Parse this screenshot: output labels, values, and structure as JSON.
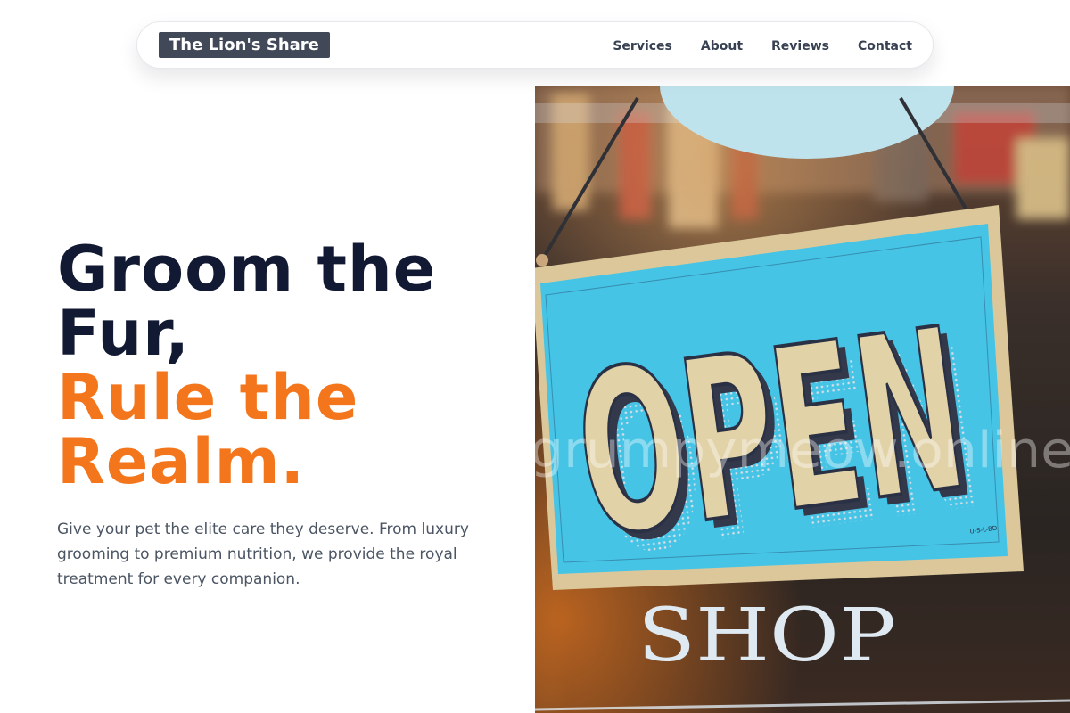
{
  "brand": {
    "name": "The Lion's Share"
  },
  "nav": {
    "items": [
      {
        "label": "Services"
      },
      {
        "label": "About"
      },
      {
        "label": "Reviews"
      },
      {
        "label": "Contact"
      }
    ]
  },
  "hero": {
    "title_lines": [
      "Groom the",
      "Fur,"
    ],
    "accent_lines": [
      "Rule the",
      "Realm."
    ],
    "subtitle": "Give your pet the elite care they deserve. From luxury grooming to premium nutrition, we provide the royal treatment for every companion.",
    "image": {
      "sign_text": "OPEN",
      "window_text": "SHOP",
      "watermark": "grumpymeow.online",
      "sign_fineprint": "U-S-L-BD"
    }
  },
  "colors": {
    "heading": "#121a33",
    "accent": "#f4761c",
    "body_text": "#4b5563",
    "logo_bg": "#414858",
    "sign_blue": "#45c4e6",
    "sign_board": "#dcc79a"
  }
}
